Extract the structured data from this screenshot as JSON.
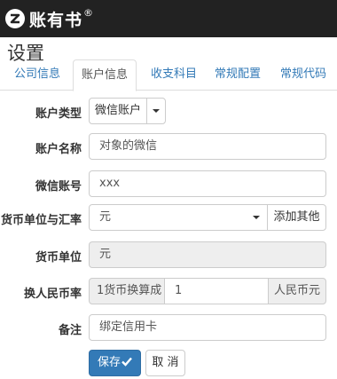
{
  "app": {
    "logo_text": "账有书",
    "logo_mark": "®"
  },
  "page_title": "设置",
  "tabs": [
    {
      "label": "公司信息",
      "active": false
    },
    {
      "label": "账户信息",
      "active": true
    },
    {
      "label": "收支科目",
      "active": false
    },
    {
      "label": "常规配置",
      "active": false
    },
    {
      "label": "常规代码",
      "active": false
    }
  ],
  "form": {
    "account_type": {
      "label": "账户类型",
      "value": "微信账户"
    },
    "account_name": {
      "label": "账户名称",
      "value": "对象的微信"
    },
    "wechat_account": {
      "label": "微信账号",
      "value": "xxx"
    },
    "currency_rate": {
      "label": "货币单位与汇率",
      "value": "元",
      "add_other": "添加其他"
    },
    "currency_unit": {
      "label": "货币单位",
      "value": "元"
    },
    "rmb_rate": {
      "label": "换人民币率",
      "prefix": "1货币换算成",
      "value": "1",
      "suffix": "人民币元"
    },
    "note": {
      "label": "备注",
      "value": "绑定信用卡"
    }
  },
  "actions": {
    "save": "保存",
    "cancel": "取 消"
  },
  "colors": {
    "topbar": "#222222",
    "primary": "#337ab7",
    "link": "#337ab7"
  }
}
